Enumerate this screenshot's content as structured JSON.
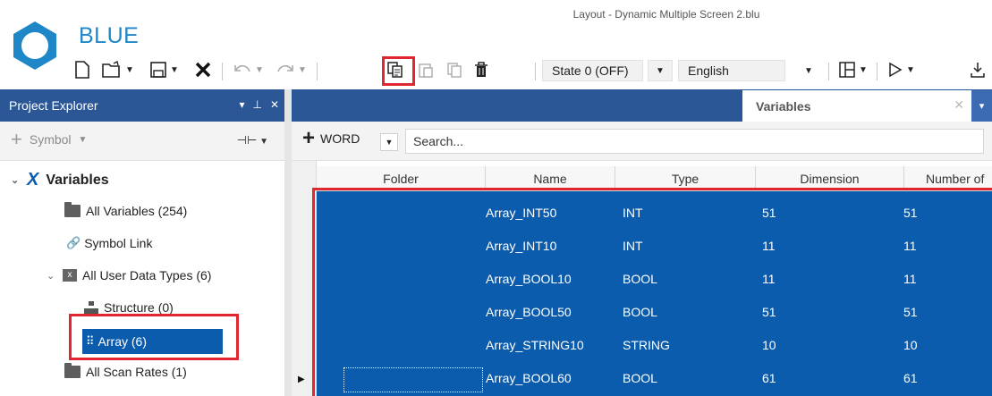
{
  "window": {
    "title": "Layout - Dynamic Multiple Screen 2.blu",
    "brand": "BLUE"
  },
  "toolbar": {
    "icons": [
      "new-file-icon",
      "open-folder-icon",
      "save-icon",
      "delete-x-icon",
      "undo-icon",
      "redo-icon",
      "copy-icon",
      "paste-icon",
      "duplicate-icon",
      "trash-icon"
    ],
    "state_value": "State 0 (OFF)",
    "language_value": "English",
    "accent": "#e0262f"
  },
  "left_panel": {
    "title": "Project Explorer",
    "add_label": "Symbol",
    "tree": {
      "root": "Variables",
      "all_variables": "All Variables (254)",
      "symbol_link": "Symbol Link",
      "user_data_types": "All User Data Types (6)",
      "structure": "Structure (0)",
      "array": "Array (6)",
      "scan_rates": "All Scan Rates (1)"
    }
  },
  "right_panel": {
    "tab_label": "Variables",
    "add_label": "WORD",
    "search_placeholder": "Search...",
    "columns": [
      "Folder",
      "Name",
      "Type",
      "Dimension",
      "Number of"
    ],
    "rows": [
      {
        "folder": "",
        "name": "Array_INT50",
        "type": "INT",
        "dimension": "51",
        "number": "51"
      },
      {
        "folder": "",
        "name": "Array_INT10",
        "type": "INT",
        "dimension": "11",
        "number": "11"
      },
      {
        "folder": "",
        "name": "Array_BOOL10",
        "type": "BOOL",
        "dimension": "11",
        "number": "11"
      },
      {
        "folder": "",
        "name": "Array_BOOL50",
        "type": "BOOL",
        "dimension": "51",
        "number": "51"
      },
      {
        "folder": "",
        "name": "Array_STRING10",
        "type": "STRING",
        "dimension": "10",
        "number": "10"
      },
      {
        "folder": "",
        "name": "Array_BOOL60",
        "type": "BOOL",
        "dimension": "61",
        "number": "61"
      }
    ]
  },
  "colors": {
    "selection": "#0b5cad",
    "header": "#2b5797",
    "brand": "#1f86c8"
  }
}
